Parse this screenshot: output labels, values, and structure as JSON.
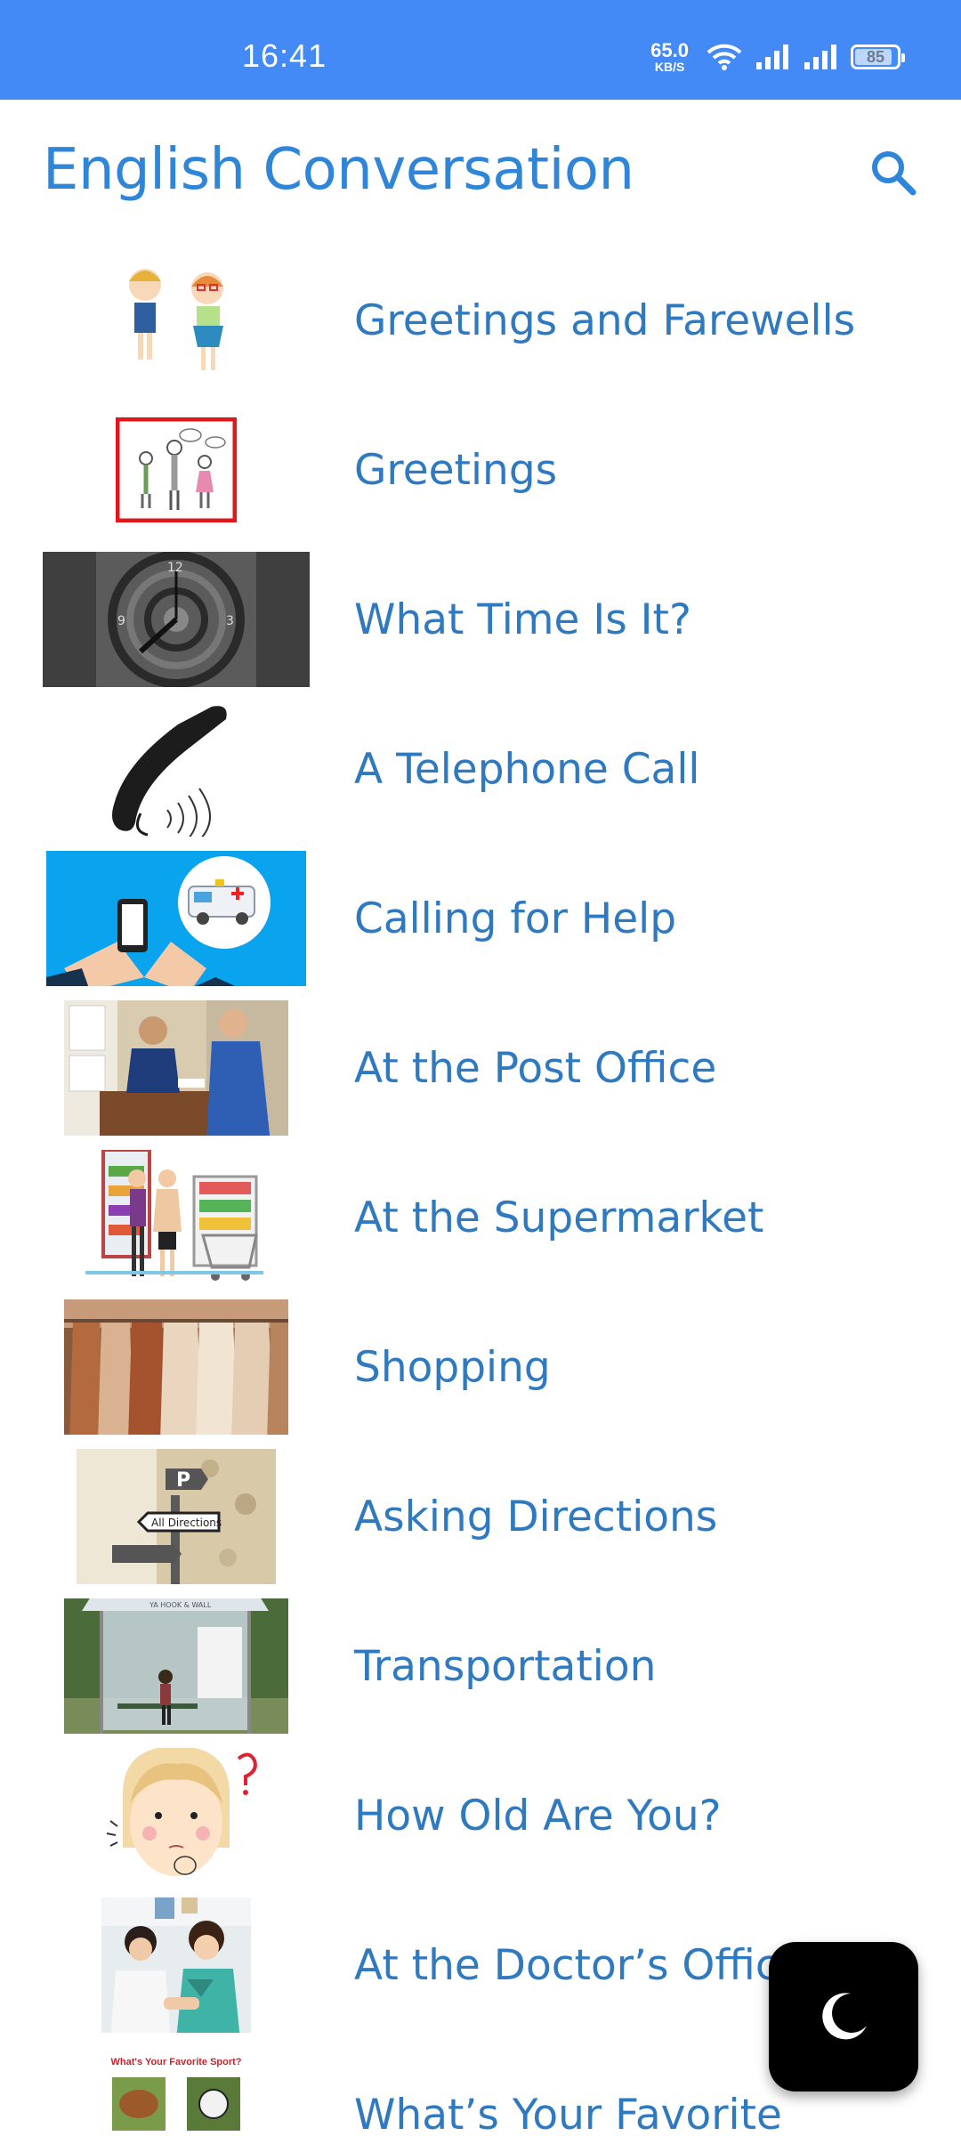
{
  "status_bar": {
    "time": "16:41",
    "net_speed_value": "65.0",
    "net_speed_unit": "KB/S",
    "battery": "85",
    "battery_fraction": 0.85
  },
  "app_bar": {
    "title": "English Conversation",
    "search_icon": "search-icon"
  },
  "lessons": [
    {
      "label": "Greetings and Farewells",
      "thumb": "kids-greeting"
    },
    {
      "label": "Greetings",
      "thumb": "people-greeting"
    },
    {
      "label": "What Time Is It?",
      "thumb": "clock-face"
    },
    {
      "label": "A Telephone Call",
      "thumb": "telephone-handset"
    },
    {
      "label": "Calling for Help",
      "thumb": "ambulance-call"
    },
    {
      "label": "At the Post Office",
      "thumb": "post-office"
    },
    {
      "label": "At the Supermarket",
      "thumb": "supermarket"
    },
    {
      "label": "Shopping",
      "thumb": "clothing-rack"
    },
    {
      "label": "Asking Directions",
      "thumb": "direction-sign"
    },
    {
      "label": "Transportation",
      "thumb": "bus-stop"
    },
    {
      "label": "How Old Are You?",
      "thumb": "confused-girl"
    },
    {
      "label": "At the Doctor’s Office",
      "thumb": "doctor-visit"
    },
    {
      "label": "What’s Your Favorite",
      "thumb": "favorite-sport",
      "thumb_caption": "What's Your Favorite Sport?"
    }
  ],
  "fab": {
    "icon": "moon-icon"
  },
  "colors": {
    "status_bar": "#448AF6",
    "title": "#2F86D9",
    "label": "#2F79C0",
    "fab": "#000000"
  }
}
